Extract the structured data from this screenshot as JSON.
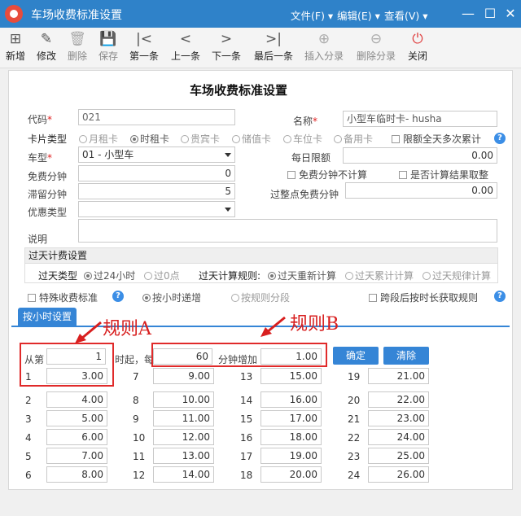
{
  "window": {
    "title": "车场收费标准设置",
    "menus": [
      "文件(F)",
      "编辑(E)",
      "查看(V)"
    ]
  },
  "toolbar": [
    "新增",
    "修改",
    "删除",
    "保存",
    "第一条",
    "上一条",
    "下一条",
    "最后一条",
    "插入分录",
    "删除分录",
    "关闭"
  ],
  "form": {
    "heading": "车场收费标准设置",
    "code_label": "代码",
    "code_value": "021",
    "name_label": "名称",
    "name_value": "小型车临时卡- husha",
    "card_type_label": "卡片类型",
    "card_types": [
      "月租卡",
      "时租卡",
      "贵宾卡",
      "储值卡",
      "车位卡",
      "备用卡"
    ],
    "card_type_selected": "时租卡",
    "limit_all_day": "限额全天多次累计",
    "vehicle_type_label": "车型",
    "vehicle_type_value": "01 - 小型车",
    "daily_limit_label": "每日限额",
    "daily_limit_value": "0.00",
    "free_minutes_label": "免费分钟",
    "free_minutes_value": "0",
    "free_minutes_not_count": "免费分钟不计算",
    "round_result": "是否计算结果取整",
    "stay_minutes_label": "滞留分钟",
    "stay_minutes_value": "5",
    "overtime_free_label": "过整点免费分钟",
    "overtime_free_value": "0.00",
    "discount_type_label": "优惠类型",
    "discount_type_value": "",
    "remark_label": "说明",
    "remark_value": "",
    "overnight_section": "过天计费设置",
    "overnight_type_label": "过天类型",
    "overnight_types": [
      "过24小时",
      "过0点"
    ],
    "overnight_type_selected": "过24小时",
    "overnight_rule_label": "过天计算规则:",
    "overnight_rules": [
      "过天重新计算",
      "过天累计计算",
      "过天规律计算"
    ],
    "overnight_rule_selected": "过天重新计算",
    "special_fee": "特殊收费标准",
    "by_hour_increase": "按小时递增",
    "by_rule_segment": "按规则分段",
    "cross_segment_hours": "跨段后按时长获取规则"
  },
  "hourly": {
    "tab": "按小时设置",
    "from_label": "从第",
    "from_value": "1",
    "hour_start_label": "时起，每",
    "every_minutes_value": "60",
    "minutes_increase_label": "分钟增加",
    "increase_value": "1.00",
    "confirm_button": "确定",
    "clear_button": "清除",
    "rows": [
      {
        "n": "1",
        "v": "3.00"
      },
      {
        "n": "2",
        "v": "4.00"
      },
      {
        "n": "3",
        "v": "5.00"
      },
      {
        "n": "4",
        "v": "6.00"
      },
      {
        "n": "5",
        "v": "7.00"
      },
      {
        "n": "6",
        "v": "8.00"
      },
      {
        "n": "7",
        "v": "9.00"
      },
      {
        "n": "8",
        "v": "10.00"
      },
      {
        "n": "9",
        "v": "11.00"
      },
      {
        "n": "10",
        "v": "12.00"
      },
      {
        "n": "11",
        "v": "13.00"
      },
      {
        "n": "12",
        "v": "14.00"
      },
      {
        "n": "13",
        "v": "15.00"
      },
      {
        "n": "14",
        "v": "16.00"
      },
      {
        "n": "15",
        "v": "17.00"
      },
      {
        "n": "16",
        "v": "18.00"
      },
      {
        "n": "17",
        "v": "19.00"
      },
      {
        "n": "18",
        "v": "20.00"
      },
      {
        "n": "19",
        "v": "21.00"
      },
      {
        "n": "20",
        "v": "22.00"
      },
      {
        "n": "21",
        "v": "23.00"
      },
      {
        "n": "22",
        "v": "24.00"
      },
      {
        "n": "23",
        "v": "25.00"
      },
      {
        "n": "24",
        "v": "26.00"
      }
    ]
  },
  "annotations": {
    "rule_a": "规则A",
    "rule_b": "规则B"
  },
  "colors": {
    "titlebar": "#2f82c9",
    "accent_button": "#3585d6",
    "annotation_red": "#d81f1f"
  }
}
